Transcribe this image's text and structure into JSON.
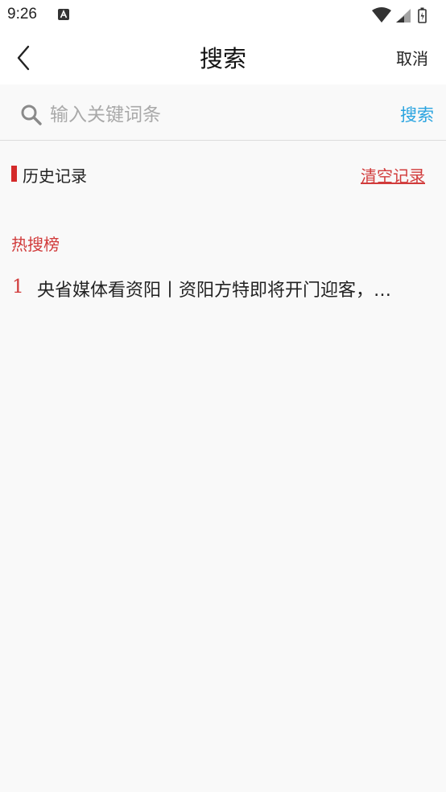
{
  "status_bar": {
    "time": "9:26"
  },
  "header": {
    "title": "搜索",
    "cancel_label": "取消"
  },
  "search": {
    "placeholder": "输入关键词条",
    "submit_label": "搜索"
  },
  "history": {
    "title": "历史记录",
    "clear_label": "清空记录",
    "items": []
  },
  "hot": {
    "title": "热搜榜",
    "items": [
      {
        "rank": "1",
        "text": "央省媒体看资阳丨资阳方特即将开门迎客，…"
      }
    ]
  },
  "colors": {
    "accent_red": "#d13b3b",
    "link_blue": "#2aa4e0"
  }
}
